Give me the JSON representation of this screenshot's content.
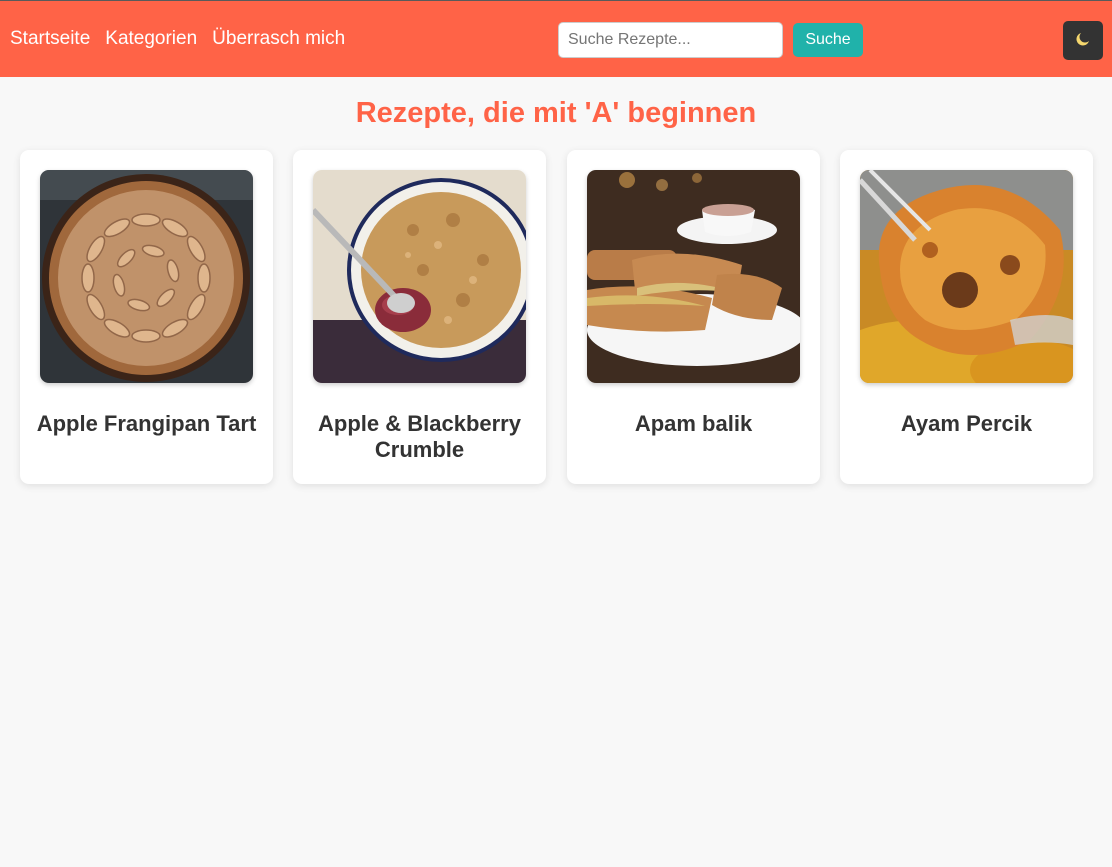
{
  "nav": {
    "links": [
      "Startseite",
      "Kategorien",
      "Überrasch mich"
    ]
  },
  "search": {
    "placeholder": "Suche Rezepte...",
    "value": "",
    "button_label": "Suche"
  },
  "theme_toggle": {
    "icon": "moon-icon"
  },
  "page": {
    "title": "Rezepte, die mit 'A' beginnen"
  },
  "recipes": [
    {
      "name": "Apple Frangipan Tart",
      "image_icon": "apple-frangipan-tart-photo"
    },
    {
      "name": "Apple & Blackberry Crumble",
      "image_icon": "apple-blackberry-crumble-photo"
    },
    {
      "name": "Apam balik",
      "image_icon": "apam-balik-photo"
    },
    {
      "name": "Ayam Percik",
      "image_icon": "ayam-percik-photo"
    }
  ],
  "colors": {
    "brand": "#ff6347",
    "accent": "#20b2aa",
    "toggle_bg": "#333333",
    "page_bg": "#f8f8f8",
    "text": "#333333"
  }
}
